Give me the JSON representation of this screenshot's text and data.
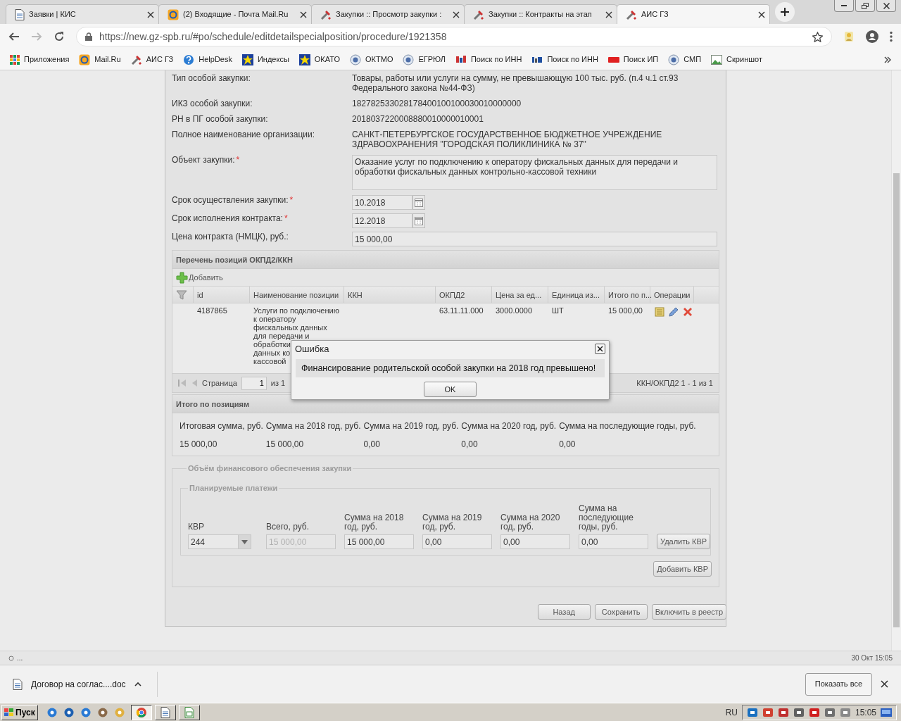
{
  "browser": {
    "tabs": [
      {
        "title": "Заявки | КИС",
        "selected": false
      },
      {
        "title": "(2) Входящие - Почта Mail.Ru",
        "selected": false
      },
      {
        "title": "Закупки :: Просмотр закупки :",
        "selected": false
      },
      {
        "title": "Закупки :: Контракты на этап",
        "selected": false
      },
      {
        "title": "АИС ГЗ",
        "selected": true
      }
    ],
    "url": "https://new.gz-spb.ru/#po/schedule/editdetailspecialposition/procedure/1921358",
    "bookmarks": [
      "Приложения",
      "Mail.Ru",
      "АИС ГЗ",
      "HelpDesk",
      "Индексы",
      "ОКАТО",
      "ОКТМО",
      "ЕГРЮЛ",
      "Поиск по ИНН",
      "Поиск по ИНН",
      "Поиск ИП",
      "СМП",
      "Скриншот"
    ]
  },
  "form": {
    "fields": [
      {
        "label": "Тип особой закупки:",
        "kind": "text",
        "value": "Товары, работы или услуги на сумму, не превышающую 100 тыс. руб. (п.4 ч.1 ст.93 Федерального закона №44-ФЗ)"
      },
      {
        "label": "ИКЗ особой закупки:",
        "kind": "text",
        "value": "182782533028178400100100030010000000"
      },
      {
        "label": "РН в ПГ особой закупки:",
        "kind": "text",
        "value": "2018037220008880010000010001"
      },
      {
        "label": "Полное наименование организации:",
        "kind": "text",
        "value": "САНКТ-ПЕТЕРБУРГСКОЕ ГОСУДАРСТВЕННОЕ БЮДЖЕТНОЕ УЧРЕЖДЕНИЕ ЗДРАВООХРАНЕНИЯ \"ГОРОДСКАЯ ПОЛИКЛИНИКА № 37\""
      },
      {
        "label": "Объект закупки:",
        "required_mark": "*",
        "kind": "textarea",
        "value": "Оказание услуг по подключению к оператору фискальных данных для передачи и обработки фискальных данных контрольно-кассовой техники"
      },
      {
        "label": "Срок осуществления закупки:",
        "required_mark": "*",
        "kind": "date",
        "value": "10.2018"
      },
      {
        "label": "Срок исполнения контракта:",
        "required_mark": "*",
        "kind": "date",
        "value": "12.2018"
      },
      {
        "label": "Цена контракта (НМЦК), руб.:",
        "kind": "input",
        "value": "15 000,00"
      }
    ]
  },
  "positions": {
    "title": "Перечень позиций ОКПД2/ККН",
    "add_button": "Добавить",
    "columns": [
      "id",
      "Наименование позиции",
      "ККН",
      "ОКПД2",
      "Цена за ед...",
      "Единица из...",
      "Итого по п...",
      "Операции"
    ],
    "rows": [
      {
        "id": "4187865",
        "name_blocks": [
          [
            "Услуги по подключению",
            "к оператору",
            "фискальных данных",
            "для передачи и"
          ],
          [
            "обработки",
            "данных ко",
            "кассовой"
          ]
        ],
        "okpd2": "63.11.11.000",
        "price": "3000.0000",
        "unit": "ШТ",
        "total": "15 000,00"
      }
    ],
    "pager": {
      "page_label": "Страница",
      "page": "1",
      "of": "из 1",
      "summary": "ККН/ОКПД2 1 - 1 из 1"
    }
  },
  "totals": {
    "title": "Итого по позициям",
    "columns": [
      "Итоговая сумма, руб.",
      "Сумма на 2018 год, руб.",
      "Сумма на 2019 год, руб.",
      "Сумма на 2020 год, руб.",
      "Сумма на последующие годы, руб."
    ],
    "values": [
      "15 000,00",
      "15 000,00",
      "0,00",
      "0,00",
      "0,00"
    ]
  },
  "financing": {
    "legend": "Объём финансового обеспечения закупки",
    "payments": {
      "legend": "Планируемые платежи",
      "columns": [
        "КВР",
        "Всего, руб.",
        "Сумма на 2018 год, руб.",
        "Сумма на 2019 год, руб.",
        "Сумма на 2020 год, руб.",
        "Сумма на последующие годы, руб."
      ],
      "kvr": "244",
      "inputs": [
        {
          "value": "15 000,00",
          "disabled": true
        },
        {
          "value": "15 000,00",
          "disabled": false
        },
        {
          "value": "0,00",
          "disabled": false
        },
        {
          "value": "0,00",
          "disabled": false
        },
        {
          "value": "0,00",
          "disabled": false
        }
      ],
      "delete_button": "Удалить КВР"
    },
    "add_button": "Добавить КВР"
  },
  "actions": [
    "Назад",
    "Сохранить",
    "Включить в реестр"
  ],
  "dialog": {
    "title": "Ошибка",
    "message": "Финансирование родительской особой закупки на 2018 год превышено!",
    "button": "OK"
  },
  "status_bar": {
    "left": "...",
    "right": "30 Окт 15:05"
  },
  "downloads": {
    "file": "Договор на соглас....doc",
    "show_all": "Показать все"
  },
  "taskbar": {
    "start": "Пуск",
    "windows": [
      {
        "selected": true
      },
      {
        "selected": false
      },
      {
        "selected": false
      }
    ],
    "language": "RU",
    "clock": "15:05"
  }
}
